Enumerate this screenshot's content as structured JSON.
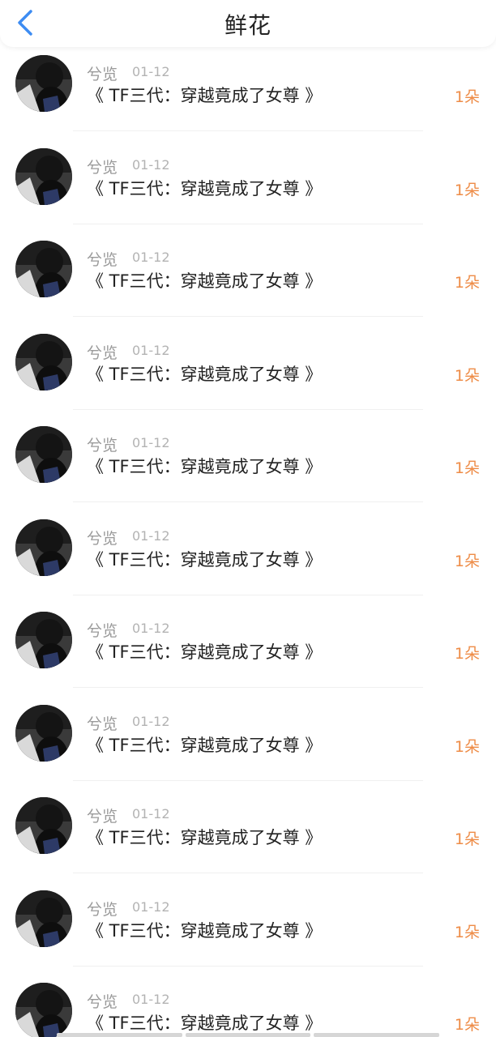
{
  "header": {
    "title": "鲜花",
    "back_icon": "chevron-left-icon",
    "accent_color": "#3d8cf2"
  },
  "colors": {
    "count": "#ee8c47",
    "name": "#9a9a9a",
    "title": "#222222"
  },
  "items": [
    {
      "user": "兮览",
      "date": "01-12",
      "book": "《 TF三代：穿越竟成了女尊 》",
      "count": "1朵"
    },
    {
      "user": "兮览",
      "date": "01-12",
      "book": "《 TF三代：穿越竟成了女尊 》",
      "count": "1朵"
    },
    {
      "user": "兮览",
      "date": "01-12",
      "book": "《 TF三代：穿越竟成了女尊 》",
      "count": "1朵"
    },
    {
      "user": "兮览",
      "date": "01-12",
      "book": "《 TF三代：穿越竟成了女尊 》",
      "count": "1朵"
    },
    {
      "user": "兮览",
      "date": "01-12",
      "book": "《 TF三代：穿越竟成了女尊 》",
      "count": "1朵"
    },
    {
      "user": "兮览",
      "date": "01-12",
      "book": "《 TF三代：穿越竟成了女尊 》",
      "count": "1朵"
    },
    {
      "user": "兮览",
      "date": "01-12",
      "book": "《 TF三代：穿越竟成了女尊 》",
      "count": "1朵"
    },
    {
      "user": "兮览",
      "date": "01-12",
      "book": "《 TF三代：穿越竟成了女尊 》",
      "count": "1朵"
    },
    {
      "user": "兮览",
      "date": "01-12",
      "book": "《 TF三代：穿越竟成了女尊 》",
      "count": "1朵"
    },
    {
      "user": "兮览",
      "date": "01-12",
      "book": "《 TF三代：穿越竟成了女尊 》",
      "count": "1朵"
    },
    {
      "user": "兮览",
      "date": "01-12",
      "book": "《 TF三代：穿越竟成了女尊 》",
      "count": "1朵"
    }
  ]
}
